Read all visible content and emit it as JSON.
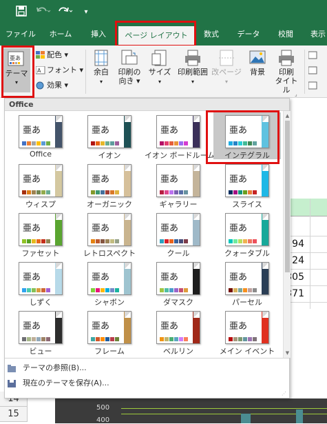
{
  "quick_access": {
    "save_icon": "save-icon",
    "undo_icon": "undo-icon",
    "redo_icon": "redo-icon",
    "more_icon": "customize-icon"
  },
  "tabs": [
    {
      "label": "ファイル"
    },
    {
      "label": "ホーム"
    },
    {
      "label": "挿入"
    },
    {
      "label": "ページ レイアウト",
      "active": true
    },
    {
      "label": "数式"
    },
    {
      "label": "データ"
    },
    {
      "label": "校閲"
    },
    {
      "label": "表示"
    }
  ],
  "ribbon": {
    "theme_button": {
      "label": "テーマ"
    },
    "colors": {
      "label": "配色"
    },
    "fonts": {
      "label": "フォント"
    },
    "effects": {
      "label": "効果"
    },
    "margins": {
      "label": "余白"
    },
    "orientation": {
      "label1": "印刷の",
      "label2": "向き"
    },
    "size": {
      "label": "サイズ"
    },
    "print_area": {
      "label": "印刷範囲"
    },
    "breaks": {
      "label": "改ページ"
    },
    "background": {
      "label": "背景"
    },
    "print_titles": {
      "label1": "印刷",
      "label2": "タイトル"
    }
  },
  "theme_gallery": {
    "section_header": "Office",
    "sample_text": "亜あ",
    "themes": [
      {
        "name": "Office",
        "accent": "#44546a",
        "swatches": [
          "#4472c4",
          "#ed7d31",
          "#a5a5a5",
          "#ffc000",
          "#5b9bd5",
          "#70ad47"
        ]
      },
      {
        "name": "イオン",
        "accent": "#1e5155",
        "swatches": [
          "#b01513",
          "#ea6312",
          "#e6b729",
          "#6aac90",
          "#5f9c9d",
          "#9e5e9b"
        ]
      },
      {
        "name": "イオン ボードルーム",
        "accent": "#3b3059",
        "swatches": [
          "#b31166",
          "#e33d6f",
          "#e45f3c",
          "#e9943a",
          "#9b6bf2",
          "#d53dd0"
        ]
      },
      {
        "name": "インテグラル",
        "accent": "#5fc2e0",
        "swatches": [
          "#1cade4",
          "#2683c6",
          "#27ced7",
          "#42ba97",
          "#3e8853",
          "#62a39f"
        ],
        "selected": true
      },
      {
        "name": "ウィスプ",
        "accent": "#d4c8a0",
        "swatches": [
          "#a53010",
          "#de7e18",
          "#9f8351",
          "#728653",
          "#92aa4c",
          "#6aac91"
        ]
      },
      {
        "name": "オーガニック",
        "accent": "#d6c09a",
        "swatches": [
          "#83992a",
          "#3c9770",
          "#44709d",
          "#a23c33",
          "#d97828",
          "#deb340"
        ]
      },
      {
        "name": "ギャラリー",
        "accent": "#c4b49a",
        "swatches": [
          "#b71e42",
          "#de478e",
          "#bc72f0",
          "#795faf",
          "#586ea6",
          "#6892a0"
        ]
      },
      {
        "name": "スライス",
        "accent": "#1fb8e6",
        "swatches": [
          "#052f61",
          "#a50e82",
          "#14967c",
          "#6a9e1f",
          "#e87d37",
          "#c62324"
        ]
      },
      {
        "name": "ファセット",
        "accent": "#5aa530",
        "swatches": [
          "#90c226",
          "#54a021",
          "#e6b91e",
          "#e76618",
          "#c42f1a",
          "#918655"
        ]
      },
      {
        "name": "レトロスペクト",
        "accent": "#c9b48e",
        "swatches": [
          "#e48312",
          "#bd582c",
          "#865640",
          "#9b8357",
          "#c2bc80",
          "#94a088"
        ]
      },
      {
        "name": "クール",
        "accent": "#9fb9c8",
        "swatches": [
          "#2da2bf",
          "#da1f28",
          "#eb641b",
          "#39639d",
          "#474b78",
          "#7d3c4a"
        ]
      },
      {
        "name": "クォータブル",
        "accent": "#17a99a",
        "swatches": [
          "#00c6bb",
          "#6feba0",
          "#b6df5e",
          "#efb251",
          "#ef755f",
          "#ed515c"
        ]
      },
      {
        "name": "しずく",
        "accent": "#b7dae9",
        "swatches": [
          "#2fa3ee",
          "#4bcaad",
          "#86c157",
          "#d99c3f",
          "#ce6633",
          "#a35dd1"
        ]
      },
      {
        "name": "シャボン",
        "accent": "#9ec4d0",
        "swatches": [
          "#7fd13b",
          "#ea157a",
          "#feb80a",
          "#00addc",
          "#738ac8",
          "#1ab39f"
        ]
      },
      {
        "name": "ダマスク",
        "accent": "#1e1e1e",
        "swatches": [
          "#9ec544",
          "#50bea3",
          "#4a9ccc",
          "#9a66ca",
          "#c54f71",
          "#de9c3c"
        ]
      },
      {
        "name": "パーセル",
        "accent": "#2a3e55",
        "swatches": [
          "#730e00",
          "#d8b25c",
          "#7ba79d",
          "#f7901e",
          "#c0a2a0",
          "#8c8c8c"
        ]
      },
      {
        "name": "ビュー",
        "accent": "#2d2d2d",
        "swatches": [
          "#6f6f74",
          "#a7b789",
          "#beae98",
          "#92a9b9",
          "#9c8265",
          "#8d6974"
        ]
      },
      {
        "name": "フレーム",
        "accent": "#c09048",
        "swatches": [
          "#40a6a2",
          "#d1572a",
          "#ff8c00",
          "#1f5d9e",
          "#b73d4b",
          "#6b8337"
        ]
      },
      {
        "name": "ベルリン",
        "accent": "#a02818",
        "swatches": [
          "#f09415",
          "#c1b56b",
          "#4baf73",
          "#5aa6c0",
          "#d17df9",
          "#fa7e5c"
        ]
      },
      {
        "name": "メイン イベント",
        "accent": "#e03020",
        "swatches": [
          "#b80e0f",
          "#a6987d",
          "#7f9a71",
          "#64969f",
          "#9b75b2",
          "#80737a"
        ]
      }
    ],
    "footer": {
      "browse": "テーマの参照(B)...",
      "save": "現在のテーマを保存(A)..."
    }
  },
  "sheet": {
    "cell_values": [
      "94",
      "24",
      "305",
      "371"
    ],
    "row_headers": [
      "14",
      "15"
    ],
    "chart_ticks": [
      "500",
      "400"
    ]
  }
}
